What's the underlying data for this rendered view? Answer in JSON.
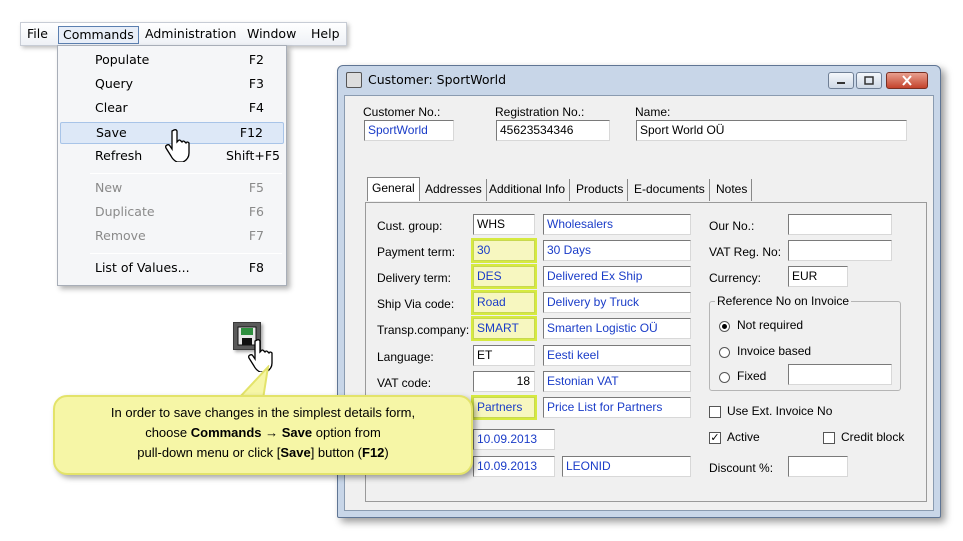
{
  "menubar": {
    "items": [
      "File",
      "Commands",
      "Administration",
      "Window",
      "Help"
    ]
  },
  "commands_menu": {
    "items": [
      {
        "label": "Populate",
        "key": "F2"
      },
      {
        "label": "Query",
        "key": "F3"
      },
      {
        "label": "Clear",
        "key": "F4"
      },
      {
        "label": "Save",
        "key": "F12"
      },
      {
        "label": "Refresh",
        "key": "Shift+F5"
      },
      {
        "label": "New",
        "key": "F5"
      },
      {
        "label": "Duplicate",
        "key": "F6"
      },
      {
        "label": "Remove",
        "key": "F7"
      },
      {
        "label": "List of Values...",
        "key": "F8"
      }
    ]
  },
  "callout": {
    "line1": "In order to save changes in the simplest details form,",
    "line2_pre": "choose ",
    "line2_cmd": "Commands",
    "line2_arrow": " → ",
    "line2_save": "Save",
    "line2_post": " option from",
    "line3_pre": "pull-down menu or click [",
    "line3_save": "Save",
    "line3_mid": "] button (",
    "line3_key": "F12",
    "line3_post": ")"
  },
  "window": {
    "title": "Customer: SportWorld",
    "customer_no_label": "Customer No.:",
    "customer_no": "SportWorld",
    "reg_no_label": "Registration No.:",
    "reg_no": "45623534346",
    "name_label": "Name:",
    "name": "Sport World OÜ",
    "tabs": [
      "General",
      "Addresses",
      "Additional Info",
      "Products",
      "E-documents",
      "Notes"
    ],
    "left": {
      "cust_group_label": "Cust. group:",
      "cust_group_code": "WHS",
      "cust_group_name": "Wholesalers",
      "payment_term_label": "Payment term:",
      "payment_term_code": "30",
      "payment_term_name": "30 Days",
      "delivery_term_label": "Delivery term:",
      "delivery_term_code": "DES",
      "delivery_term_name": "Delivered Ex Ship",
      "ship_via_label": "Ship Via code:",
      "ship_via_code": "Road",
      "ship_via_name": "Delivery by Truck",
      "transp_label": "Transp.company:",
      "transp_code": "SMART",
      "transp_name": "Smarten Logistic OÜ",
      "language_label": "Language:",
      "language_code": "ET",
      "language_name": "Eesti keel",
      "vat_label": "VAT code:",
      "vat_code": "18",
      "vat_name": "Estonian VAT",
      "price_list_code": "Partners",
      "price_list_name": "Price List for Partners",
      "date1": "10.09.2013",
      "date2": "10.09.2013",
      "user": "LEONID"
    },
    "right": {
      "our_no_label": "Our No.:",
      "our_no": "",
      "vat_reg_label": "VAT Reg. No:",
      "vat_reg": "",
      "currency_label": "Currency:",
      "currency": "EUR",
      "ref_group_title": "Reference No on Invoice",
      "radio_not_required": "Not required",
      "radio_invoice_based": "Invoice based",
      "radio_fixed": "Fixed",
      "fixed_value": "",
      "use_ext_invoice": "Use Ext. Invoice No",
      "active": "Active",
      "credit_block": "Credit block",
      "discount_label": "Discount %:",
      "discount": ""
    }
  }
}
